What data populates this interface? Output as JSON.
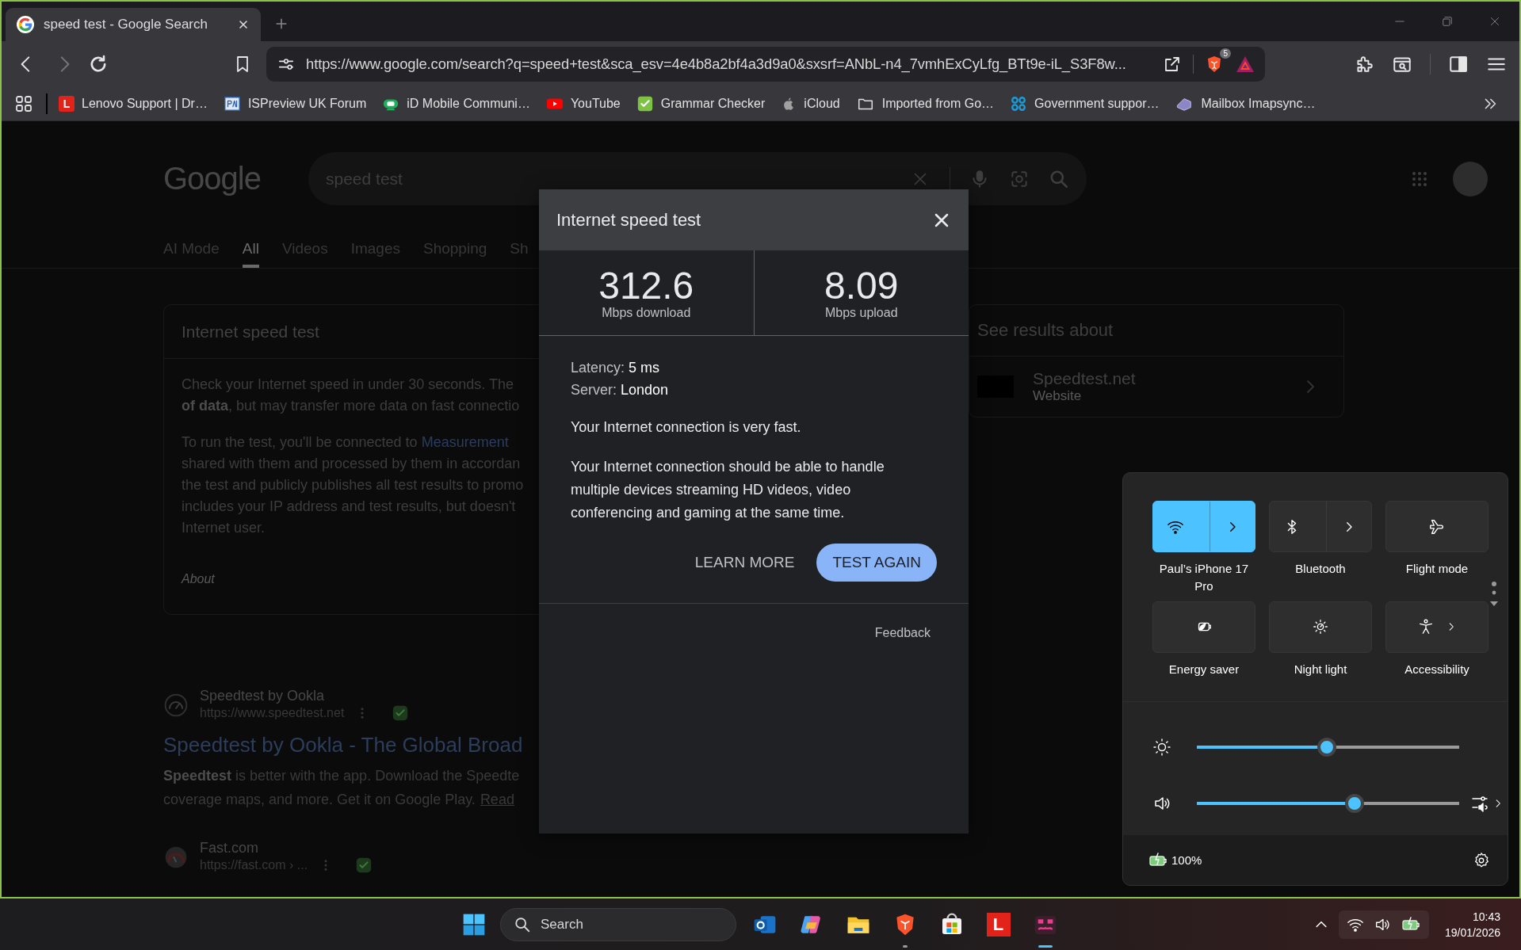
{
  "browser": {
    "tabs": [
      {
        "title": "speed test - Google Search",
        "selected": true
      }
    ],
    "nav": {
      "back": {
        "disabled": false
      },
      "forward": {
        "disabled": true
      }
    },
    "url": "https://www.google.com/search?q=speed+test&sca_esv=4e4b8a2bf4a3d9a0&sxsrf=ANbL-n4_7vmhExCyLfg_BTt9e-iL_S3F8w...",
    "shield_count": "5",
    "bookmarks": [
      {
        "label": "Lenovo Support | Dr…",
        "glyph": "L"
      },
      {
        "label": "ISPreview UK Forum"
      },
      {
        "label": "iD Mobile Communi…"
      },
      {
        "label": "YouTube"
      },
      {
        "label": "Grammar Checker"
      },
      {
        "label": "iCloud"
      },
      {
        "label": "Imported from Go…"
      },
      {
        "label": "Government suppor…"
      },
      {
        "label": "Mailbox Imapsync…"
      }
    ]
  },
  "google": {
    "logo": "Google",
    "search_value": "speed test",
    "tabs": [
      {
        "label": "AI Mode",
        "selected": false
      },
      {
        "label": "All",
        "selected": true
      },
      {
        "label": "Videos",
        "selected": false
      },
      {
        "label": "Images",
        "selected": false
      },
      {
        "label": "Shopping",
        "selected": false
      },
      {
        "label": "Sh",
        "selected": false
      }
    ],
    "answer_card": {
      "title": "Internet speed test",
      "paragraphs": [
        [
          {
            "text": "Check your Internet speed in under 30 seconds. The"
          },
          {
            "text": "**of data**, but may transfer more data on fast connectio"
          }
        ],
        [
          {
            "text": "To run the test, you'll be connected to",
            "link": "Measurement"
          },
          {
            "text": "shared with them and processed by them in accordan"
          },
          {
            "text": "the test and publicly publishes all test results to promo"
          },
          {
            "text": "includes your IP address and test results, but doesn't"
          },
          {
            "text": "Internet user."
          }
        ]
      ],
      "about": "About"
    },
    "about_card": {
      "title": "See results about",
      "name": "Speedtest.net",
      "type": "Website"
    },
    "results": [
      {
        "site": "Speedtest by Ookla",
        "url": "https://www.speedtest.net",
        "title": "Speedtest by Ookla - The Global Broad",
        "snippet": [
          "**Speedtest** is better with the app. Download the Speedte",
          "coverage maps, and more. Get it on Google Play."
        ],
        "link": "Read"
      },
      {
        "site": "Fast.com",
        "url": "https://fast.com › ..."
      }
    ]
  },
  "dialog": {
    "title": "Internet speed test",
    "stats": [
      {
        "value": "312.6",
        "unit": "Mbps download"
      },
      {
        "value": "8.09",
        "unit": "Mbps upload"
      }
    ],
    "details": [
      {
        "label": "Latency:",
        "value": "5 ms"
      },
      {
        "label": "Server:",
        "value": "London"
      }
    ],
    "verdict": "Your Internet connection is very fast.",
    "explanation": "Your Internet connection should be able to handle multiple devices streaming HD videos, video conferencing and gaming at the same time.",
    "buttons": [
      {
        "label": "LEARN MORE",
        "kind": "text"
      },
      {
        "label": "TEST AGAIN",
        "kind": "filled"
      }
    ],
    "feedback": "Feedback"
  },
  "quick_settings": {
    "tiles": [
      {
        "label": "Paul’s iPhone 17 Pro",
        "kind": "split",
        "on": true
      },
      {
        "label": "Bluetooth",
        "kind": "split",
        "on": false
      },
      {
        "label": "Flight mode",
        "kind": "plain",
        "on": false
      },
      {
        "label": "Energy saver",
        "kind": "plain",
        "on": false
      },
      {
        "label": "Night light",
        "kind": "plain",
        "on": false
      },
      {
        "label": "Accessibility",
        "kind": "chevron",
        "on": false
      }
    ],
    "sliders": [
      {
        "kind": "brightness",
        "level": 0.495
      },
      {
        "kind": "volume",
        "level": 0.6
      }
    ],
    "battery": "100%"
  },
  "taskbar": {
    "search_placeholder": "Search",
    "apps": [
      {
        "running": false,
        "active": false
      },
      {
        "running": false,
        "active": false
      },
      {
        "running": false,
        "active": false
      },
      {
        "running": true,
        "active": false
      },
      {
        "running": false,
        "active": false
      },
      {
        "running": false,
        "active": false,
        "glyph": "L"
      },
      {
        "running": true,
        "active": true
      }
    ],
    "time": "10:43",
    "date": "19/01/2026"
  }
}
